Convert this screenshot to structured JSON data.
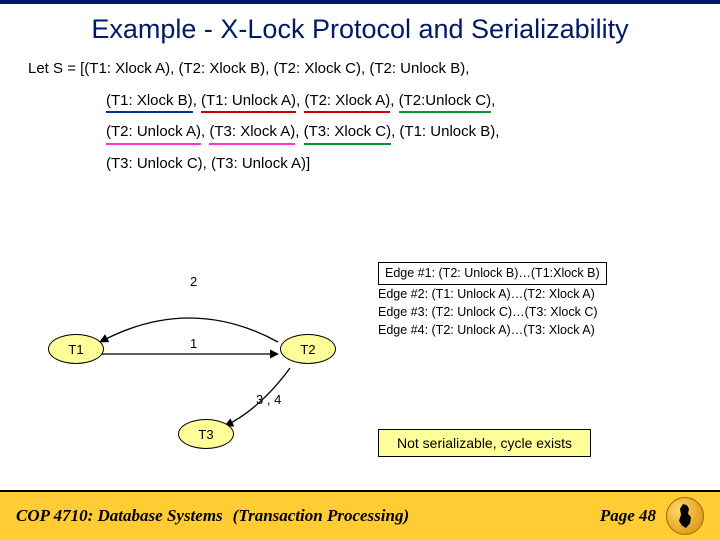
{
  "title": "Example - X-Lock Protocol and Serializability",
  "schedule": {
    "prefix": "Let S = [",
    "line1_rest": "(T1: Xlock A), (T2: Xlock B), (T2: Xlock C), (T2: Unlock B),",
    "line2": {
      "seg1_pre": "(T1: Xlock B)",
      "gap1": ", ",
      "seg2_pre": "(T1: Unlock A)",
      "gap2": ", ",
      "seg3_pre": "(T2: Xlock A)",
      "gap3": ", ",
      "seg4_pre": "(T2:Unlock C)",
      "tail": ","
    },
    "line3": {
      "seg1": "(T2: Unlock A)",
      "gap1": ", ",
      "seg2": "(T3: Xlock A)",
      "gap2": ", ",
      "seg3": "(T3: Xlock C)",
      "rest": ", (T1: Unlock B),"
    },
    "line4": "(T3: Unlock C), (T3: Unlock A)]"
  },
  "nodes": {
    "t1": "T1",
    "t2": "T2",
    "t3": "T3"
  },
  "edge_labels": {
    "e12_top": "2",
    "e12_bot": "1",
    "e23": "3 , 4"
  },
  "edges_legend": {
    "e1": "Edge #1:  (T2: Unlock B)…(T1:Xlock B)",
    "e2": "Edge #2:  (T1: Unlock A)…(T2: Xlock A)",
    "e3": "Edge #3:  (T2: Unlock C)…(T3: Xlock C)",
    "e4": "Edge #4:  (T2: Unlock A)…(T3: Xlock A)"
  },
  "result": "Not serializable, cycle exists",
  "footer": {
    "course": "COP 4710: Database Systems",
    "topic": "(Transaction Processing)",
    "page": "Page 48"
  }
}
